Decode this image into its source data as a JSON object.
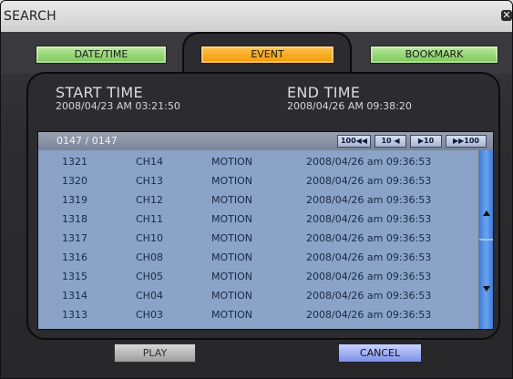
{
  "window": {
    "title": "SEARCH",
    "close_glyph": "✕"
  },
  "tabs": [
    {
      "label": "DATE/TIME",
      "active": false
    },
    {
      "label": "EVENT",
      "active": true
    },
    {
      "label": "BOOKMARK",
      "active": false
    }
  ],
  "time_range": {
    "start_label": "START TIME",
    "start_value": "2008/04/23 AM 03:21:50",
    "end_label": "END TIME",
    "end_value": "2008/04/26 AM 09:38:20"
  },
  "table": {
    "count": "0147 / 0147",
    "nav": [
      {
        "label": "100◀◀",
        "name": "back-100-button"
      },
      {
        "label": "10 ◀",
        "name": "back-10-button"
      },
      {
        "label": "▶10",
        "name": "forward-10-button"
      },
      {
        "label": "▶▶100",
        "name": "forward-100-button"
      }
    ],
    "rows": [
      {
        "id": "1321",
        "channel": "CH14",
        "type": "MOTION",
        "time": "2008/04/26 am 09:36:53"
      },
      {
        "id": "1320",
        "channel": "CH13",
        "type": "MOTION",
        "time": "2008/04/26 am 09:36:53"
      },
      {
        "id": "1319",
        "channel": "CH12",
        "type": "MOTION",
        "time": "2008/04/26 am 09:36:53"
      },
      {
        "id": "1318",
        "channel": "CH11",
        "type": "MOTION",
        "time": "2008/04/26 am 09:36:53"
      },
      {
        "id": "1317",
        "channel": "CH10",
        "type": "MOTION",
        "time": "2008/04/26 am 09:36:53"
      },
      {
        "id": "1316",
        "channel": "CH08",
        "type": "MOTION",
        "time": "2008/04/26 am 09:36:53"
      },
      {
        "id": "1315",
        "channel": "CH05",
        "type": "MOTION",
        "time": "2008/04/26 am 09:36:53"
      },
      {
        "id": "1314",
        "channel": "CH04",
        "type": "MOTION",
        "time": "2008/04/26 am 09:36:53"
      },
      {
        "id": "1313",
        "channel": "CH03",
        "type": "MOTION",
        "time": "2008/04/26 am 09:36:53"
      }
    ]
  },
  "buttons": {
    "play": "PLAY",
    "cancel": "CANCEL"
  },
  "colors": {
    "tab_inactive": "#8fd16b",
    "tab_active": "#f5a61a",
    "list_background": "#8aa3c6",
    "scrollbar": "#4f8fe8",
    "cancel_button": "#8fa0f0"
  }
}
